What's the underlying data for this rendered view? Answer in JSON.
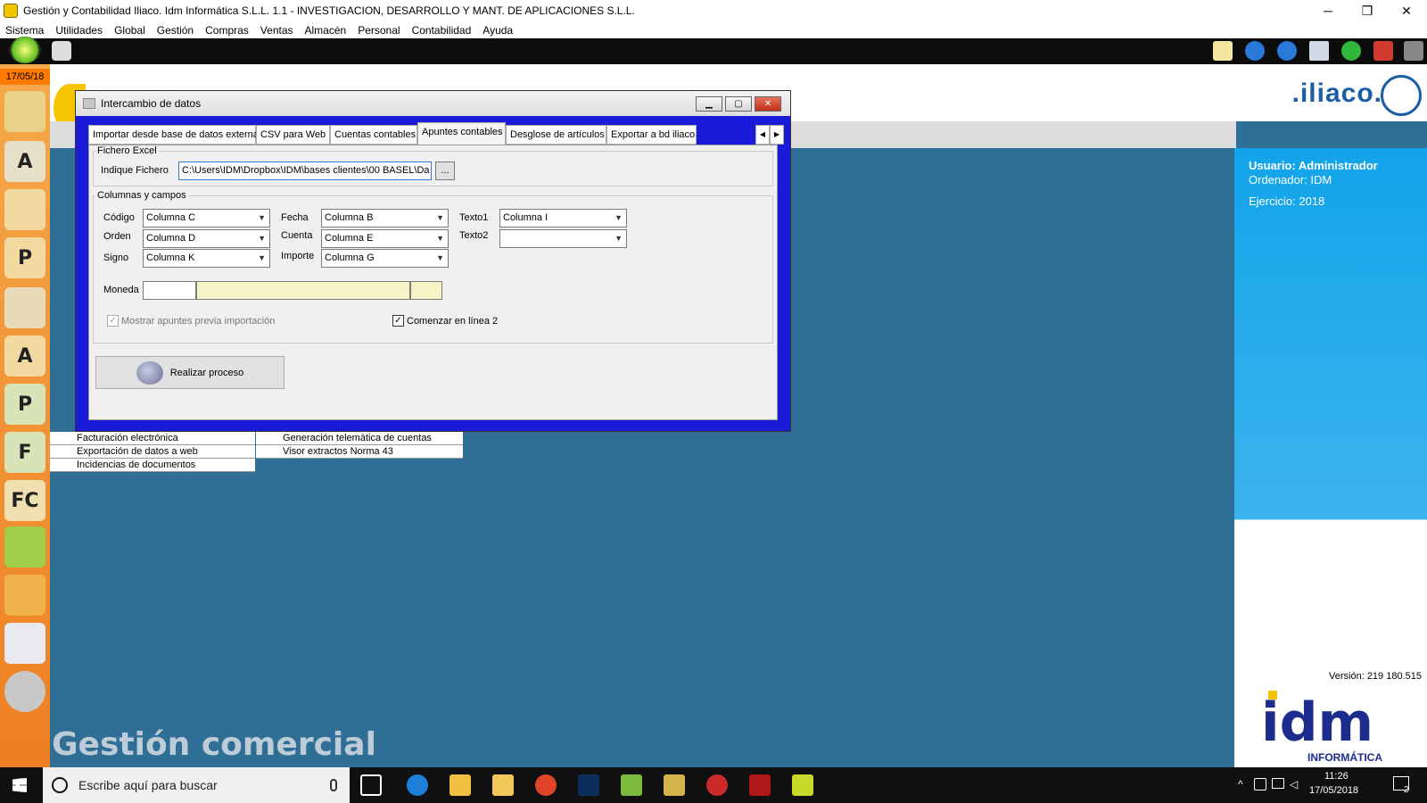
{
  "window": {
    "title": "Gestión y Contabilidad Iliaco. Idm Informática S.L.L. 1.1 - INVESTIGACION, DESARROLLO Y MANT. DE APLICACIONES S.L.L.",
    "controls": {
      "minimize": "─",
      "restore": "❐",
      "close": "✕"
    }
  },
  "menu": [
    "Sistema",
    "Utilidades",
    "Global",
    "Gestión",
    "Compras",
    "Ventas",
    "Almacén",
    "Personal",
    "Contabilidad",
    "Ayuda"
  ],
  "sidebar": {
    "date": "17/05/18",
    "buttons": [
      "users",
      "contacts",
      "user",
      "user-p",
      "group",
      "user-a",
      "P",
      "F",
      "FC",
      "bag-green",
      "bag-orange",
      "list",
      "disc"
    ]
  },
  "header": {
    "logo": ".iliaco."
  },
  "info": {
    "usuario": "Usuario: Administrador",
    "ordenador": "Ordenador: IDM",
    "ejercicio": "Ejercicio: 2018",
    "version": "Versión: 219 180.515"
  },
  "idm_logo": {
    "main": "idm",
    "sub": "INFORMÁTICA"
  },
  "background_list": {
    "col1": [
      "Facturación electrónica",
      "Exportación de datos a web",
      "Incidencias de documentos"
    ],
    "col2": [
      "Generación telemática de cuentas",
      "Visor extractos Norma 43"
    ]
  },
  "brand": "Gestión comercial",
  "dialog": {
    "title": "Intercambio de datos",
    "tabs": [
      "Importar desde base de datos externa",
      "CSV para Web",
      "Cuentas contables",
      "Apuntes contables",
      "Desglose de artículos",
      "Exportar a bd iliaco"
    ],
    "active_tab": "Apuntes contables",
    "excel_group": "Fichero Excel",
    "file_label": "Indique Fichero",
    "file_value": "C:\\Users\\IDM\\Dropbox\\IDM\\bases clientes\\00 BASEL\\Da",
    "browse": "...",
    "columns_group": "Columnas y campos",
    "fields": {
      "codigo": {
        "label": "Código",
        "value": "Columna C"
      },
      "orden": {
        "label": "Orden",
        "value": "Columna D"
      },
      "signo": {
        "label": "Signo",
        "value": "Columna K"
      },
      "fecha": {
        "label": "Fecha",
        "value": "Columna B"
      },
      "cuenta": {
        "label": "Cuenta",
        "value": "Columna E"
      },
      "importe": {
        "label": "Importe",
        "value": "Columna G"
      },
      "texto1": {
        "label": "Texto1",
        "value": "Columna I"
      },
      "texto2": {
        "label": "Texto2",
        "value": ""
      }
    },
    "moneda_label": "Moneda",
    "mostrar_apuntes": {
      "label": "Mostrar apuntes previa importación",
      "checked": true,
      "enabled": false
    },
    "comenzar_linea": {
      "label": "Comenzar en línea 2",
      "checked": true
    },
    "process_button": "Realizar proceso"
  },
  "taskbar": {
    "search_placeholder": "Escribe aquí para buscar",
    "time": "11:26",
    "date": "17/05/2018",
    "notifications": "2"
  }
}
